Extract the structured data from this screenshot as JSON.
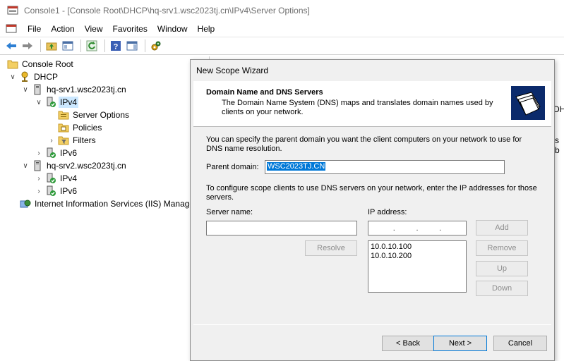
{
  "window": {
    "title": "Console1 - [Console Root\\DHCP\\hq-srv1.wsc2023tj.cn\\IPv4\\Server Options]"
  },
  "menu": [
    "File",
    "Action",
    "View",
    "Favorites",
    "Window",
    "Help"
  ],
  "tree": {
    "console_root": "Console Root",
    "dhcp": "DHCP",
    "srv1": "hq-srv1.wsc2023tj.cn",
    "srv1_ipv4": "IPv4",
    "server_options": "Server Options",
    "policies": "Policies",
    "filters": "Filters",
    "srv1_ipv6": "IPv6",
    "srv2": "hq-srv2.wsc2023tj.cn",
    "srv2_ipv4": "IPv4",
    "srv2_ipv6": "IPv6",
    "iis": "Internet Information Services (IIS) Manage"
  },
  "right_pane": {
    "peek1": "DH",
    "peek2": "s b"
  },
  "dialog": {
    "title": "New Scope Wizard",
    "header_title": "Domain Name and DNS Servers",
    "header_desc": "The Domain Name System (DNS) maps and translates domain names used by clients on your network.",
    "intro": "You can specify the parent domain you want the client computers on your network to use for DNS name resolution.",
    "parent_domain_label": "Parent domain:",
    "parent_domain_value": "WSC2023TJ.CN",
    "scope_text": "To configure scope clients to use DNS servers on your network, enter the IP addresses for those servers.",
    "server_name_label": "Server name:",
    "ip_address_label": "IP address:",
    "server_name_value": "",
    "ip_placeholder_dots": [
      ".",
      ".",
      "."
    ],
    "ip_list": [
      "10.0.10.100",
      "10.0.10.200"
    ],
    "buttons": {
      "resolve": "Resolve",
      "add": "Add",
      "remove": "Remove",
      "up": "Up",
      "down": "Down",
      "back": "< Back",
      "next": "Next >",
      "cancel": "Cancel"
    }
  },
  "colors": {
    "selection": "#cce8ff",
    "highlight": "#0078d7",
    "dialog_bg": "#f0f0f0"
  }
}
